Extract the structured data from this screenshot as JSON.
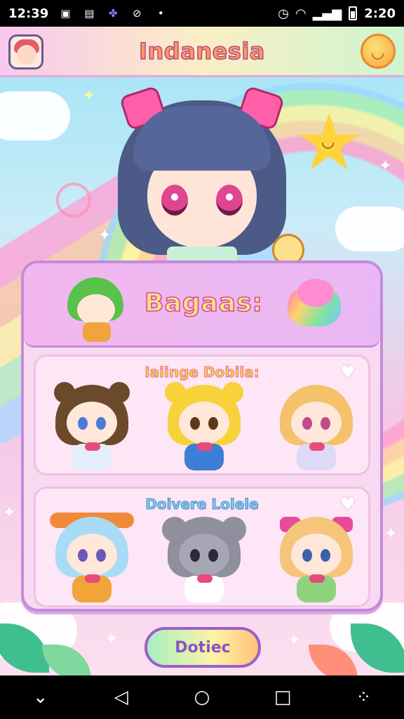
{
  "status_bar": {
    "time_left": "12:39",
    "notif_icons": [
      "image-notif-icon",
      "gallery-notif-icon",
      "pinwheel-notif-icon",
      "box-notif-icon",
      "dot-notif-icon"
    ],
    "right_text": "2:20"
  },
  "header": {
    "title": "Indanesia"
  },
  "banner": {
    "title": "Bagaas:"
  },
  "rows": [
    {
      "title": "Iaiinge Dobila:",
      "characters": [
        {
          "name": "brown-bear-girl",
          "hair": "#6b4a2b",
          "eyes": "#4b7bd6",
          "body": "#e4eefc"
        },
        {
          "name": "yellow-bear",
          "hair": "#f7d23a",
          "eyes": "#5b3a1a",
          "body": "#3d7ed6"
        },
        {
          "name": "blonde-bow-girl",
          "hair": "#f3c26b",
          "eyes": "#c04b8e",
          "body": "#dcdaf7"
        }
      ]
    },
    {
      "title": "Doivere Lolele",
      "characters": [
        {
          "name": "flower-crown-girl",
          "hair": "#a8dcf5",
          "eyes": "#6b57b8",
          "body": "#f0a43a"
        },
        {
          "name": "grey-mouse",
          "hair": "#8f8f9e",
          "eyes": "#2a2a38",
          "body": "#ffffff"
        },
        {
          "name": "blonde-pink-bow-girl",
          "hair": "#f5c57a",
          "eyes": "#3c5fb0",
          "body": "#8fd27e"
        }
      ]
    }
  ],
  "cta": {
    "label": "Dotiec"
  },
  "nav": {
    "icons": [
      "chevron-down-icon",
      "back-icon",
      "home-icon",
      "recents-icon",
      "more-icon"
    ]
  },
  "colors": {
    "header_title": "#ff9a5a",
    "panel_border": "#c58ad9",
    "cta_border": "#9b5fc9"
  }
}
